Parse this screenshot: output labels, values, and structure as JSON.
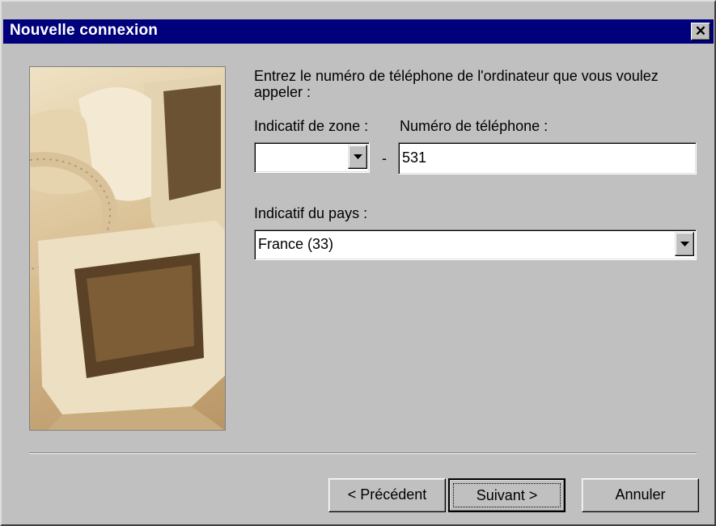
{
  "window": {
    "title": "Nouvelle connexion",
    "close_symbol": "✕",
    "colors": {
      "titlebar": "#00007c",
      "face": "#c0c0c0"
    }
  },
  "illustration": {
    "description_icon": "computer-phone-illustration"
  },
  "instruction": "Entrez le numéro de téléphone de l'ordinateur que vous voulez appeler :",
  "area_code": {
    "label": "Indicatif de zone :",
    "value": ""
  },
  "phone": {
    "label": "Numéro de téléphone :",
    "value": "531"
  },
  "separator_dash": "-",
  "country": {
    "label": "Indicatif du pays :",
    "value": "France (33)"
  },
  "buttons": {
    "prev": "< Précédent",
    "next": "Suivant >",
    "cancel": "Annuler"
  }
}
